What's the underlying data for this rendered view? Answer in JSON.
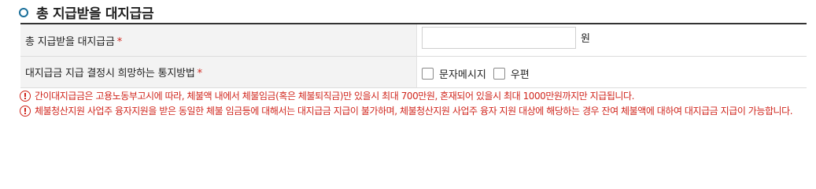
{
  "section": {
    "title": "총 지급받을 대지급금"
  },
  "form": {
    "rows": [
      {
        "label": "총 지급받을 대지급금",
        "required_mark": "*",
        "input_value": "",
        "unit": "원"
      },
      {
        "label": "대지급금 지급 결정시 희망하는 통지방법",
        "required_mark": "*",
        "options": [
          {
            "label": "문자메시지",
            "checked": false
          },
          {
            "label": "우편",
            "checked": false
          }
        ]
      }
    ]
  },
  "notices": [
    "간이대지급금은 고용노동부고시에 따라, 체불액 내에서 체불임금(혹은 체불퇴직금)만 있을시 최대 700만원, 혼재되어 있을시 최대 1000만원까지만 지급됩니다.",
    "체불청산지원 사업주 융자지원을 받은 동일한 체불 임금등에 대해서는 대지급금 지급이 불가하며, 체불청산지원 사업주 융자 지원 대상에 해당하는 경우 잔여 체불액에 대하여 대지급금 지급이 가능합니다."
  ],
  "colors": {
    "accent": "#1a6f9a",
    "required": "#d0261d",
    "notice": "#d0261d",
    "label_bg": "#f3f3f3"
  }
}
